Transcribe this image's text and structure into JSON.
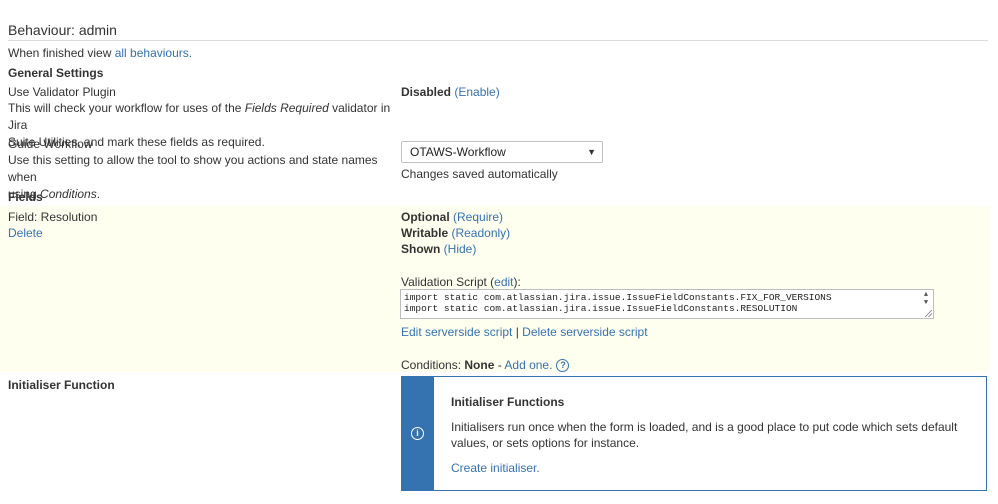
{
  "header": {
    "title": "Behaviour: admin"
  },
  "nav": {
    "prefix": "When finished view ",
    "link": "all behaviours."
  },
  "general": {
    "heading": "General Settings",
    "validator": {
      "label": "Use Validator Plugin",
      "desc_line1_a": "This will check your workflow for uses of the ",
      "desc_line1_em": "Fields Required",
      "desc_line1_b": " validator in Jira",
      "desc_line2": "Suite Utilities, and mark these fields as required.",
      "status": "Disabled",
      "action": "(Enable)"
    },
    "workflow": {
      "label": "Guide Workflow",
      "desc_line1": "Use this setting to allow the tool to show you actions and state names when",
      "desc_line2_a": "using ",
      "desc_line2_em": "Conditions",
      "desc_line2_b": ".",
      "selected": "OTAWS-Workflow",
      "saved_note": "Changes saved automatically"
    }
  },
  "fields": {
    "heading": "Fields",
    "field_label": "Field: Resolution",
    "delete_link": "Delete",
    "optional": "Optional",
    "require_link": "(Require)",
    "writable": "Writable",
    "readonly_link": "(Readonly)",
    "shown": "Shown",
    "hide_link": "(Hide)",
    "script_label_a": "Validation Script (",
    "script_edit_link": "edit",
    "script_label_b": "):",
    "script_line1": "import static com.atlassian.jira.issue.IssueFieldConstants.FIX_FOR_VERSIONS",
    "script_line2": "import static com.atlassian.jira.issue.IssueFieldConstants.RESOLUTION",
    "edit_server_link": "Edit serverside script",
    "separator": " | ",
    "delete_server_link": "Delete serverside script",
    "conditions_label": "Conditions: ",
    "conditions_value": "None",
    "conditions_dash": " - ",
    "add_one_link": "Add one.",
    "help_glyph": "?"
  },
  "initialiser": {
    "heading": "Initialiser Function",
    "panel_icon_glyph": "i",
    "panel_title": "Initialiser Functions",
    "panel_text": "Initialisers run once when the form is loaded, and is a good place to put code which sets default values, or sets options for instance.",
    "create_link": "Create initialiser."
  },
  "colors": {
    "link": "#3572b0",
    "field_bg": "#fffff0",
    "panel_border": "#3572b0"
  }
}
